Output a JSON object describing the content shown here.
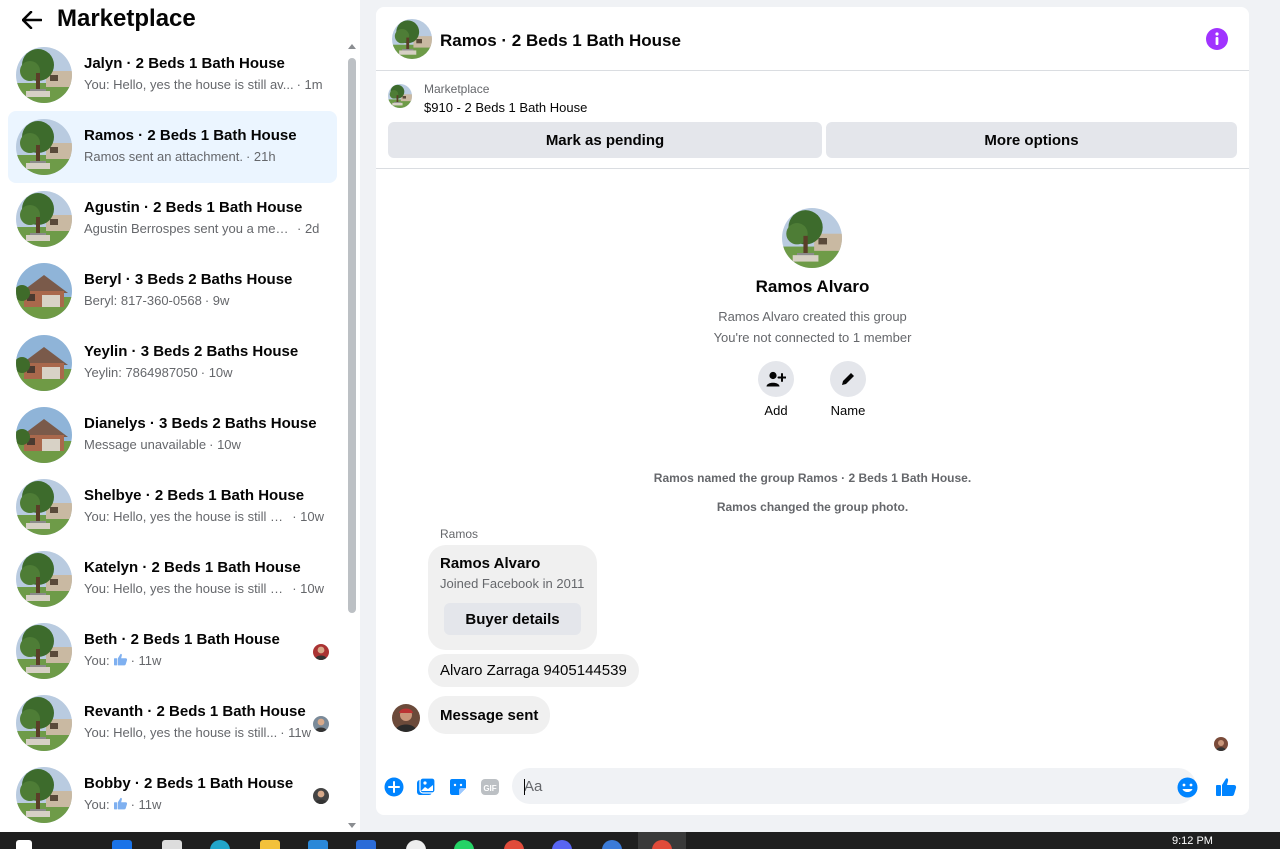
{
  "sidebar": {
    "title": "Marketplace",
    "conversations": [
      {
        "name": "Jalyn · 2 Beds 1 Bath House",
        "snippet": "You: Hello, yes the house is still av...",
        "time": "· 1m",
        "active": false,
        "house": "tree"
      },
      {
        "name": "Ramos · 2 Beds 1 Bath House",
        "snippet": "Ramos sent an attachment.",
        "time": "· 21h",
        "active": true,
        "house": "tree"
      },
      {
        "name": "Agustin · 2 Beds 1 Bath House",
        "snippet": "Agustin Berrospes sent you a mess...",
        "time": "· 2d",
        "active": false,
        "house": "tree"
      },
      {
        "name": "Beryl · 3 Beds 2 Baths House",
        "snippet": "Beryl: 817-360-0568",
        "time": "· 9w",
        "active": false,
        "house": "brick"
      },
      {
        "name": "Yeylin · 3 Beds 2 Baths House",
        "snippet": "Yeylin: 7864987050",
        "time": "· 10w",
        "active": false,
        "house": "brick"
      },
      {
        "name": "Dianelys · 3 Beds 2 Baths House",
        "snippet": "Message unavailable",
        "time": "· 10w",
        "active": false,
        "house": "brick"
      },
      {
        "name": "Shelbye · 2 Beds 1 Bath House",
        "snippet": "You: Hello, yes the house is still av...",
        "time": "· 10w",
        "active": false,
        "house": "tree"
      },
      {
        "name": "Katelyn · 2 Beds 1 Bath House",
        "snippet": "You: Hello, yes the house is still av...",
        "time": "· 10w",
        "active": false,
        "house": "tree"
      },
      {
        "name": "Beth · 2 Beds 1 Bath House",
        "snippet": "You:",
        "time": "· 11w",
        "active": false,
        "house": "tree",
        "like": true,
        "mini": "#a33"
      },
      {
        "name": "Revanth · 2 Beds 1 Bath House",
        "snippet": "You: Hello, yes the house is still...",
        "time": "· 11w",
        "active": false,
        "house": "tree",
        "mini": "#7a8a99"
      },
      {
        "name": "Bobby · 2 Beds 1 Bath House",
        "snippet": "You:",
        "time": "· 11w",
        "active": false,
        "house": "tree",
        "like": true,
        "mini": "#444"
      }
    ]
  },
  "chat": {
    "title": "Ramos · 2 Beds 1 Bath House",
    "listing": {
      "source": "Marketplace",
      "title": "$910 - 2 Beds 1 Bath House",
      "mark_pending": "Mark as pending",
      "more_options": "More options"
    },
    "group": {
      "name": "Ramos Alvaro",
      "created": "Ramos Alvaro created this group",
      "connection": "You're not connected to 1 member",
      "add_label": "Add",
      "name_label": "Name"
    },
    "system_messages": [
      "Ramos named the group Ramos · 2 Beds 1 Bath House.",
      "Ramos changed the group photo."
    ],
    "sender_label": "Ramos",
    "card": {
      "name": "Ramos Alvaro",
      "sub": "Joined Facebook in 2011",
      "button": "Buyer details"
    },
    "messages": [
      "Alvaro Zarraga 9405144539",
      "Message sent"
    ],
    "composer": {
      "placeholder": "Aa"
    }
  },
  "taskbar": {
    "time": "9:12 PM"
  },
  "colors": {
    "accent": "#0084ff",
    "info": "#a033ff",
    "active_row": "#ebf5ff"
  }
}
